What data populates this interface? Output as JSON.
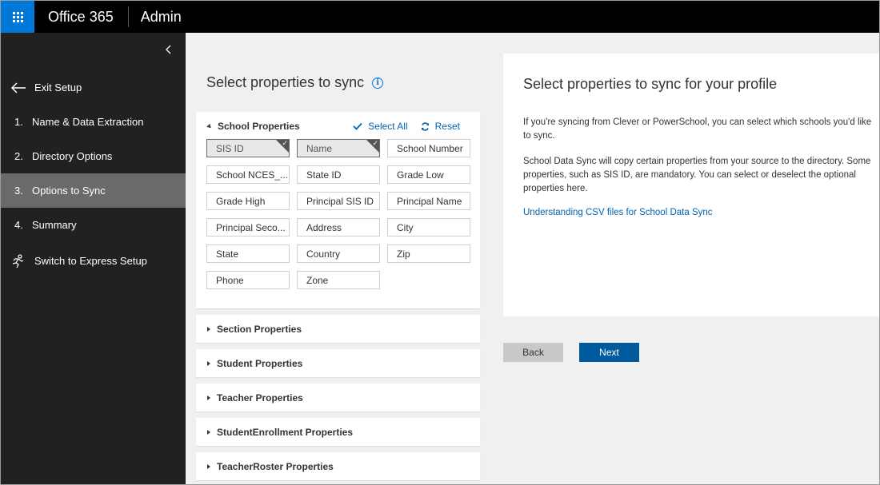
{
  "topbar": {
    "brand": "Office 365",
    "app_name": "Admin",
    "accent_color": "#0078d7"
  },
  "sidebar": {
    "exit_label": "Exit Setup",
    "steps": [
      {
        "num": "1.",
        "label": "Name & Data Extraction",
        "active": false
      },
      {
        "num": "2.",
        "label": "Directory Options",
        "active": false
      },
      {
        "num": "3.",
        "label": "Options to Sync",
        "active": true
      },
      {
        "num": "4.",
        "label": "Summary",
        "active": false
      }
    ],
    "express_label": "Switch to Express Setup"
  },
  "main": {
    "title": "Select properties to sync",
    "school": {
      "header": "School Properties",
      "select_all": "Select All",
      "reset": "Reset",
      "properties": [
        {
          "label": "SIS ID",
          "selected": true
        },
        {
          "label": "Name",
          "selected": true
        },
        {
          "label": "School Number",
          "selected": false
        },
        {
          "label": "School NCES_...",
          "selected": false
        },
        {
          "label": "State ID",
          "selected": false
        },
        {
          "label": "Grade Low",
          "selected": false
        },
        {
          "label": "Grade High",
          "selected": false
        },
        {
          "label": "Principal SIS ID",
          "selected": false
        },
        {
          "label": "Principal Name",
          "selected": false
        },
        {
          "label": "Principal Seco...",
          "selected": false
        },
        {
          "label": "Address",
          "selected": false
        },
        {
          "label": "City",
          "selected": false
        },
        {
          "label": "State",
          "selected": false
        },
        {
          "label": "Country",
          "selected": false
        },
        {
          "label": "Zip",
          "selected": false
        },
        {
          "label": "Phone",
          "selected": false
        },
        {
          "label": "Zone",
          "selected": false
        }
      ]
    },
    "collapsed_sections": [
      "Section Properties",
      "Student Properties",
      "Teacher Properties",
      "StudentEnrollment Properties",
      "TeacherRoster Properties"
    ]
  },
  "info_panel": {
    "title": "Select properties to sync for your profile",
    "paragraph1": "If you're syncing from Clever or PowerSchool, you can select which schools you'd like to sync.",
    "paragraph2": "School Data Sync will copy certain properties from your source to the directory. Some properties, such as SIS ID, are mandatory. You can select or deselect the optional properties here.",
    "link": "Understanding CSV files for School Data Sync"
  },
  "buttons": {
    "back": "Back",
    "next": "Next"
  }
}
